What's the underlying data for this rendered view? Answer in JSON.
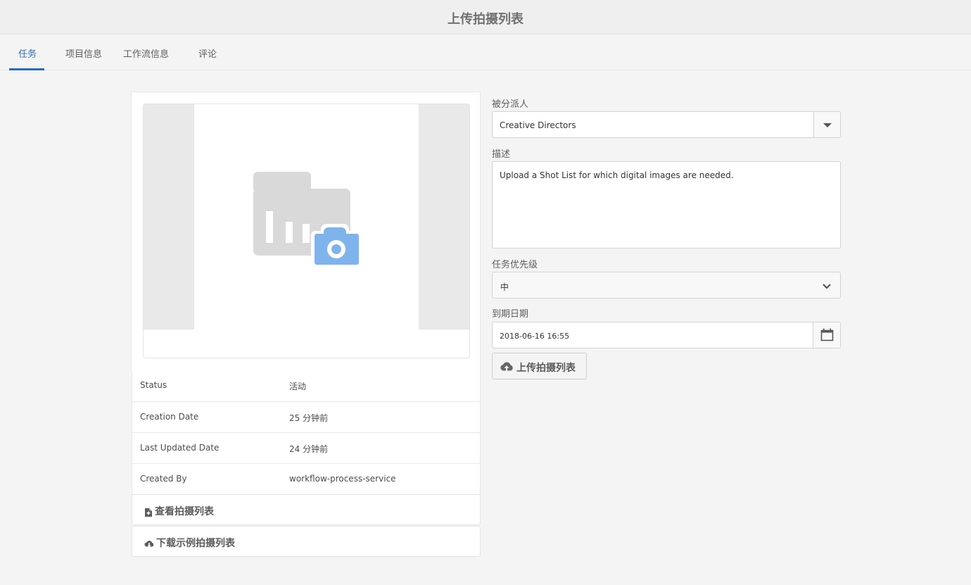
{
  "header": {
    "title": "上传拍摄列表"
  },
  "tabs": [
    {
      "label": "任务",
      "active": true
    },
    {
      "label": "项目信息"
    },
    {
      "label": "工作流信息"
    },
    {
      "label": "评论"
    }
  ],
  "details": [
    {
      "label": "Status",
      "value": "活动"
    },
    {
      "label": "Creation Date",
      "value": "25 分钟前"
    },
    {
      "label": "Last Updated Date",
      "value": "24 分钟前"
    },
    {
      "label": "Created By",
      "value": "workflow-process-service"
    }
  ],
  "actions": {
    "view_label": "查看拍摄列表",
    "download_label": "下载示例拍摄列表"
  },
  "form": {
    "assignee_label": "被分派人",
    "assignee_value": "Creative Directors",
    "description_label": "描述",
    "description_value": "Upload a Shot List for which digital images are needed.",
    "priority_label": "任务优先级",
    "priority_value": "中",
    "due_label": "到期日期",
    "due_value": "2018-06-16 16:55",
    "upload_label": "上传拍摄列表"
  },
  "icons": {
    "thumbnail": "folder-chart-camera-icon",
    "assignee_toggle": "caret-down-icon",
    "priority_toggle": "chevron-down-icon",
    "date_picker": "calendar-icon",
    "upload": "cloud-upload-icon",
    "view": "file-icon",
    "download": "cloud-download-icon"
  },
  "colors": {
    "accent": "#2c6bb8",
    "camera": "#7fb3ec",
    "placeholder_gray": "#d9d9d9"
  }
}
